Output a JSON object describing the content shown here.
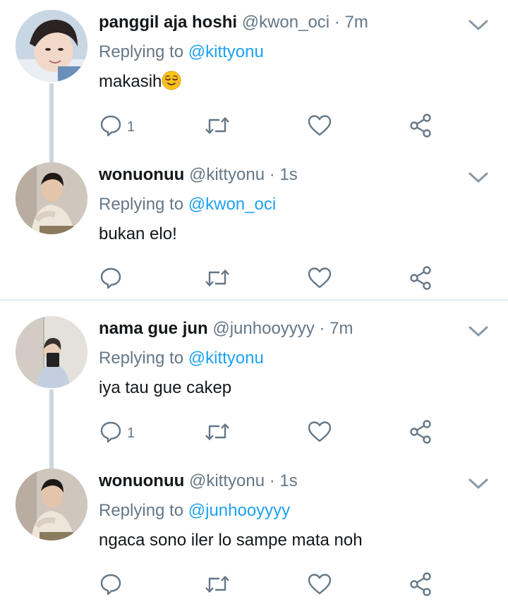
{
  "colors": {
    "text": "#14171a",
    "muted": "#657786",
    "link": "#1da1f2",
    "icon": "#657786",
    "thread_line": "#ccd6dd"
  },
  "tweets": [
    {
      "display_name": "panggil aja hoshi",
      "handle": "@kwon_oci",
      "separator": "·",
      "time": "7m",
      "replying_prefix": "Replying to",
      "replying_to": "@kittyonu",
      "text": "makasih",
      "emoji": "relieved-face",
      "reply_count": "1",
      "icons": [
        "reply-icon",
        "retweet-icon",
        "like-icon",
        "share-icon"
      ]
    },
    {
      "display_name": "wonuonuu",
      "handle": "@kittyonu",
      "separator": "·",
      "time": "1s",
      "replying_prefix": "Replying to",
      "replying_to": "@kwon_oci",
      "text": "bukan elo!",
      "reply_count": "",
      "icons": [
        "reply-icon",
        "retweet-icon",
        "like-icon",
        "share-icon"
      ]
    },
    {
      "display_name": "nama gue jun",
      "handle": "@junhooyyyy",
      "separator": "·",
      "time": "7m",
      "replying_prefix": "Replying to",
      "replying_to": "@kittyonu",
      "text": "iya tau gue cakep",
      "reply_count": "1",
      "icons": [
        "reply-icon",
        "retweet-icon",
        "like-icon",
        "share-icon"
      ]
    },
    {
      "display_name": "wonuonuu",
      "handle": "@kittyonu",
      "separator": "·",
      "time": "1s",
      "replying_prefix": "Replying to",
      "replying_to": "@junhooyyyy",
      "text": "ngaca sono iler lo sampe mata noh",
      "reply_count": "",
      "icons": [
        "reply-icon",
        "retweet-icon",
        "like-icon",
        "share-icon"
      ]
    }
  ]
}
